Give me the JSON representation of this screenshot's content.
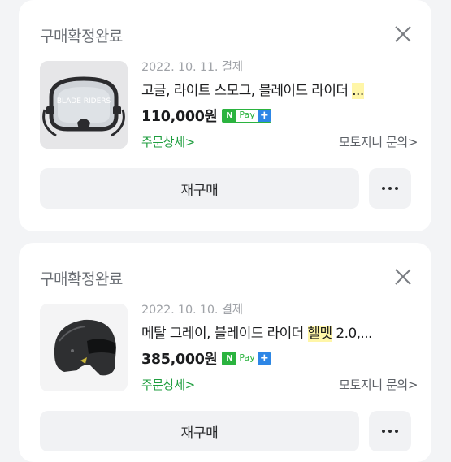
{
  "orders": [
    {
      "status": "구매확정완료",
      "date": "2022. 10. 11. 결제",
      "title_before": "고글, 라이트 스모그, 블레이드 라이더 ",
      "title_highlight": "...",
      "price": "110,000원",
      "npay": {
        "n": "N",
        "pay": "Pay",
        "plus": "+"
      },
      "detail_link": "주문상세>",
      "inquiry_link": "모토지니 문의>",
      "rebuy_label": "재구매",
      "thumb_text": "BLADE RIDERS"
    },
    {
      "status": "구매확정완료",
      "date": "2022. 10. 10. 결제",
      "title_before": "메탈 그레이, 블레이드 라이더 ",
      "title_highlight": "헬멧",
      "title_after": " 2.0,...",
      "price": "385,000원",
      "npay": {
        "n": "N",
        "pay": "Pay",
        "plus": "+"
      },
      "detail_link": "주문상세>",
      "inquiry_link": "모토지니 문의>",
      "rebuy_label": "재구매"
    }
  ],
  "colors": {
    "accent_green": "#1f9e3f",
    "highlight": "#fff6a8",
    "npay_green": "#2bb33f",
    "npay_blue": "#2d86e6"
  },
  "icons": {
    "close": "close-icon",
    "more": "more-dots-icon"
  }
}
